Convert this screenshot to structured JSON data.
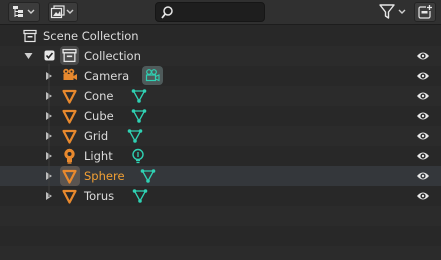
{
  "search": {
    "placeholder": "",
    "value": ""
  },
  "scene": {
    "label": "Scene Collection"
  },
  "collection": {
    "label": "Collection",
    "checked": true
  },
  "objects": [
    {
      "label": "Camera",
      "type": "camera",
      "data_icon": "camera-data-icon",
      "selected": false
    },
    {
      "label": "Cone",
      "type": "mesh",
      "data_icon": "mesh-data-icon",
      "selected": false
    },
    {
      "label": "Cube",
      "type": "mesh",
      "data_icon": "mesh-data-icon",
      "selected": false
    },
    {
      "label": "Grid",
      "type": "mesh",
      "data_icon": "mesh-data-icon",
      "selected": false
    },
    {
      "label": "Light",
      "type": "light",
      "data_icon": "light-data-icon",
      "selected": false
    },
    {
      "label": "Sphere",
      "type": "mesh",
      "data_icon": "mesh-data-icon",
      "selected": true
    },
    {
      "label": "Torus",
      "type": "mesh",
      "data_icon": "mesh-data-icon",
      "selected": false
    }
  ],
  "colors": {
    "background": "#282828",
    "header": "#303030",
    "object_orange": "#e8892e",
    "data_teal": "#2fd1b3",
    "selected_text": "#f2a034",
    "text": "#dcdcdc"
  }
}
